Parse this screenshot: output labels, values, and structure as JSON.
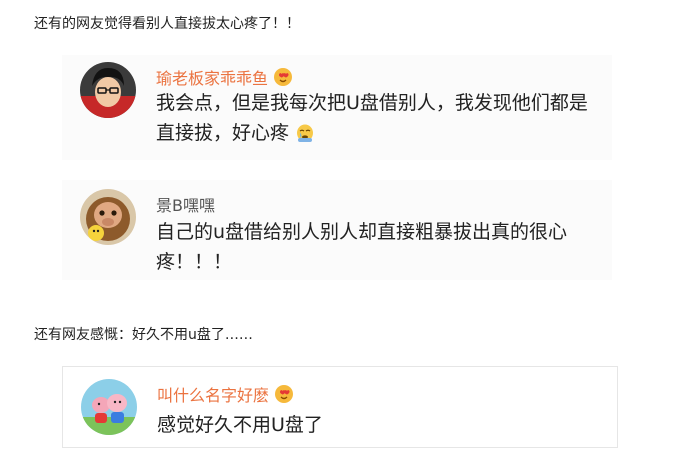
{
  "intro_lines": [
    "还有的网友觉得看别人直接拔太心疼了！！",
    "还有网友感慨：好久不用u盘了……"
  ],
  "colors": {
    "username": "#eb7340",
    "username_plain": "#555555",
    "card_background": "#fbfbfb",
    "card_border": "#e6e6e6"
  },
  "comments": [
    {
      "username": "瑜老板家乖乖鱼",
      "has_badge": true,
      "badge_icon": "heart-badge-icon",
      "text": "我会点，但是我每次把U盘借别人，我发现他们都是直接拔，好心疼",
      "trailing_emoji": "crying-emoji-icon"
    },
    {
      "username": "景B嘿嘿",
      "has_badge": false,
      "text": "自己的u盘借给别人别人却直接粗暴拔出真的很心疼！！！"
    },
    {
      "username": "叫什么名字好麽",
      "has_badge": true,
      "badge_icon": "heart-badge-icon",
      "text": "感觉好久不用U盘了"
    }
  ]
}
